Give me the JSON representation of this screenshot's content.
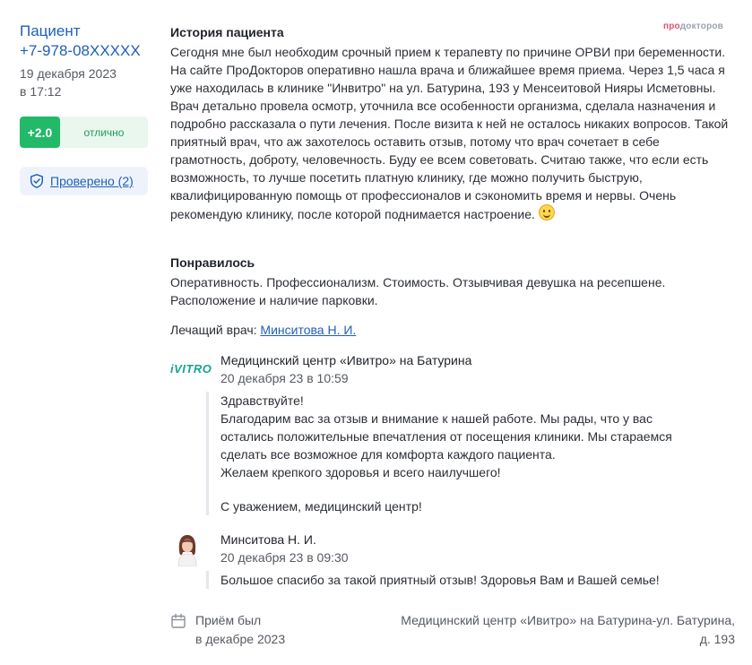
{
  "author": {
    "name": "Пациент",
    "phone": "+7-978-08XXXXX",
    "date": "19 декабря 2023",
    "time": "в 17:12"
  },
  "rating": {
    "score": "+2.0",
    "label": "отлично",
    "score_color": "#22b968"
  },
  "verified": {
    "label": "Проверено (2)",
    "icon": "shield-check-icon"
  },
  "logo": {
    "part1": "про",
    "part2": "докторов"
  },
  "story": {
    "title": "История пациента",
    "text": "Сегодня мне был необходим срочный прием к терапевту по причине ОРВИ при беременности. На сайте ПроДокторов оперативно нашла врача и ближайшее время приема. Через 1,5 часа я уже находилась в клинике \"Инвитро\" на ул. Батурина, 193 у Менсеитовой Нияры Исметовны. Врач детально провела осмотр, уточнила все особенности организма, сделала назначения и подробно рассказала о пути лечения. После визита к ней не осталось никаких вопросов. Такой приятный врач, что аж захотелось оставить отзыв, потому что врач сочетает в себе грамотность, доброту, человечность. Буду ее всем советовать. Считаю также, что если есть возможность, то лучше посетить платную клинику, где можно получить быструю, квалифицированную помощь от профессионалов и сэкономить время и нервы. Очень рекомендую клинику, после которой поднимается настроение.",
    "emoji": "smile-icon"
  },
  "liked": {
    "title": "Понравилось",
    "text": "Оперативность. Профессионализм. Стоимость. Отзывчивая девушка на ресепшене. Расположение и наличие парковки."
  },
  "doctor": {
    "prefix": "Лечащий врач:",
    "name": "Минситова Н. И."
  },
  "clinic_reply": {
    "logo": "iVITRO",
    "author": "Медицинский центр «Ивитро» на Батурина",
    "date": "20 декабря 23 в 10:59",
    "lines": [
      "Здравствуйте!",
      "Благодарим вас за отзыв и внимание к нашей работе. Мы рады, что у вас",
      "остались положительные впечатления от посещения клиники. Мы стараемся",
      "сделать все возможное для комфорта каждого пациента.",
      "Желаем крепкого здоровья и всего наилучшего!"
    ],
    "signature": "С уважением, медицинский центр!"
  },
  "doctor_reply": {
    "author": "Минситова Н. И.",
    "date": "20 декабря 23 в 09:30",
    "text": "Большое спасибо за такой приятный отзыв! Здоровья Вам и Вашей семье!"
  },
  "footer": {
    "visit_line1": "Приём был",
    "visit_line2": "в декабре 2023",
    "clinic_line1": "Медицинский центр «Ивитро» на Батурина-ул. Батурина,",
    "clinic_line2": "д. 193",
    "icon": "calendar-icon"
  }
}
